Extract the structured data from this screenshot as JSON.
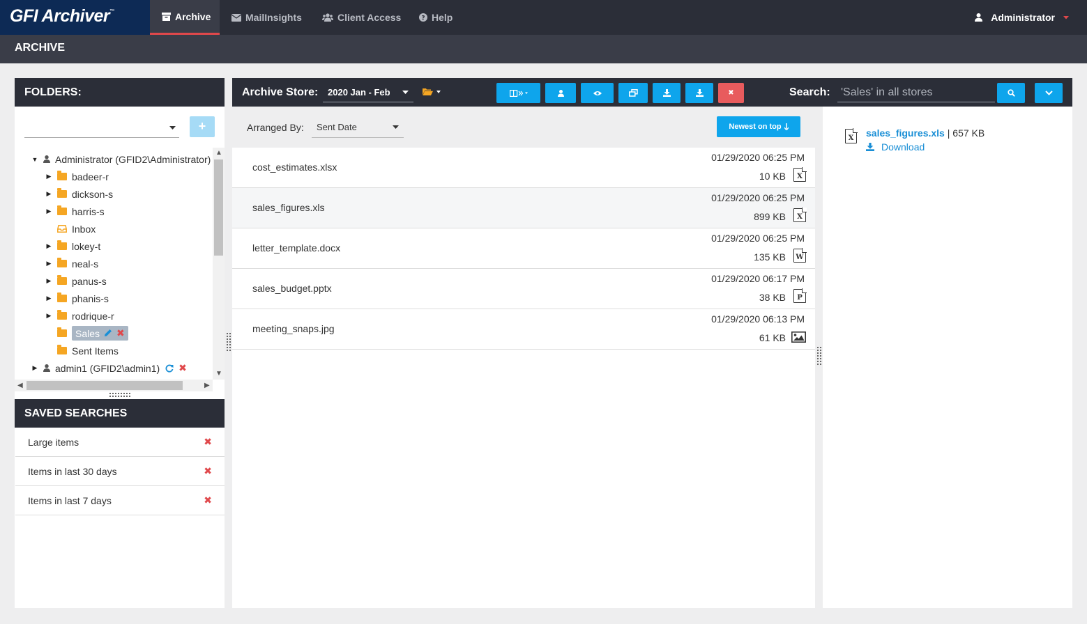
{
  "app": {
    "logo": "GFI Archiver",
    "tm": "™"
  },
  "nav": [
    {
      "label": "Archive",
      "icon": "archive-icon",
      "active": true
    },
    {
      "label": "MailInsights",
      "icon": "envelope-icon"
    },
    {
      "label": "Client Access",
      "icon": "users-icon"
    },
    {
      "label": "Help",
      "icon": "help-icon"
    }
  ],
  "user": {
    "name": "Administrator"
  },
  "page": {
    "title": "ARCHIVE"
  },
  "folders": {
    "title": "FOLDERS:",
    "select_value": "",
    "add_label": "+",
    "tree": [
      {
        "label": "Administrator (GFID2\\Administrator)",
        "level": 0,
        "toggle": "expanded",
        "icon": "user-icon"
      },
      {
        "label": "badeer-r",
        "level": 1,
        "toggle": "collapsed",
        "icon": "folder-icon"
      },
      {
        "label": "dickson-s",
        "level": 1,
        "toggle": "collapsed",
        "icon": "folder-icon"
      },
      {
        "label": "harris-s",
        "level": 1,
        "toggle": "collapsed",
        "icon": "folder-icon"
      },
      {
        "label": "Inbox",
        "level": 1,
        "toggle": "none",
        "icon": "inbox-icon"
      },
      {
        "label": "lokey-t",
        "level": 1,
        "toggle": "collapsed",
        "icon": "folder-icon"
      },
      {
        "label": "neal-s",
        "level": 1,
        "toggle": "collapsed",
        "icon": "folder-icon"
      },
      {
        "label": "panus-s",
        "level": 1,
        "toggle": "collapsed",
        "icon": "folder-icon"
      },
      {
        "label": "phanis-s",
        "level": 1,
        "toggle": "collapsed",
        "icon": "folder-icon"
      },
      {
        "label": "rodrique-r",
        "level": 1,
        "toggle": "collapsed",
        "icon": "folder-icon"
      },
      {
        "label": "Sales",
        "level": 1,
        "toggle": "none",
        "icon": "folder-icon",
        "selected": true
      },
      {
        "label": "Sent Items",
        "level": 1,
        "toggle": "none",
        "icon": "folder-icon"
      },
      {
        "label": "admin1 (GFID2\\admin1)",
        "level": 0,
        "toggle": "collapsed",
        "icon": "user-icon"
      }
    ]
  },
  "saved_searches": {
    "title": "SAVED SEARCHES",
    "items": [
      {
        "label": "Large items"
      },
      {
        "label": "Items in last 30 days"
      },
      {
        "label": "Items in last 7 days"
      }
    ]
  },
  "toolbar": {
    "store_label": "Archive Store:",
    "store_value": "2020 Jan - Feb",
    "search_label": "Search:",
    "search_value": "'Sales' in all stores",
    "buttons": [
      "columns-icon",
      "user-icon",
      "eye-icon",
      "windows-icon",
      "download-icon",
      "download-icon",
      "delete-icon"
    ]
  },
  "list": {
    "arranged_label": "Arranged By:",
    "arranged_value": "Sent Date",
    "sort_button": "Newest on top",
    "items": [
      {
        "name": "cost_estimates.xlsx",
        "date": "01/29/2020 06:25 PM",
        "size": "10 KB",
        "type": "excel"
      },
      {
        "name": "sales_figures.xls",
        "date": "01/29/2020 06:25 PM",
        "size": "899 KB",
        "type": "excel",
        "selected": true
      },
      {
        "name": "letter_template.docx",
        "date": "01/29/2020 06:25 PM",
        "size": "135 KB",
        "type": "word"
      },
      {
        "name": "sales_budget.pptx",
        "date": "01/29/2020 06:17 PM",
        "size": "38 KB",
        "type": "powerpoint"
      },
      {
        "name": "meeting_snaps.jpg",
        "date": "01/29/2020 06:13 PM",
        "size": "61 KB",
        "type": "image"
      }
    ]
  },
  "preview": {
    "file_name": "sales_figures.xls",
    "separator": "|",
    "file_size": "657 KB",
    "download_label": "Download"
  },
  "colors": {
    "accent": "#0ea5ec",
    "dark": "#2b2e38",
    "danger": "#e0484b",
    "folder": "#f5a623",
    "link": "#1a8fd6"
  }
}
